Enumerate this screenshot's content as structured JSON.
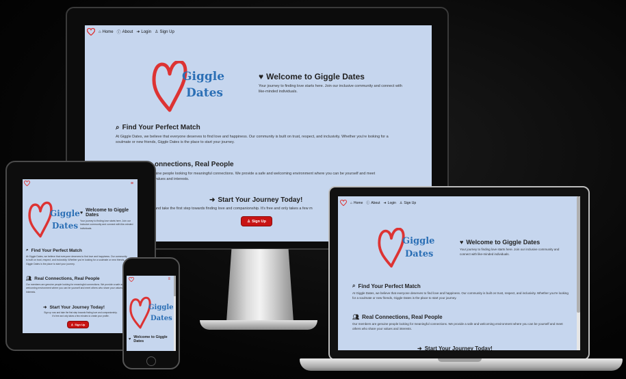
{
  "site": {
    "brand_line1": "Giggle",
    "brand_line2": "Dates",
    "nav": {
      "home": "Home",
      "about": "About",
      "login": "Login",
      "signup": "Sign Up"
    },
    "welcome": {
      "title": "Welcome to Giggle Dates",
      "text": "Your journey to finding love starts here. Join our inclusive community and connect with like-minded individuals."
    },
    "find": {
      "title": "Find Your Perfect Match",
      "text": "At Giggle Dates, we believe that everyone deserves to find love and happiness. Our community is built on trust, respect, and inclusivity. Whether you're looking for a soulmate or new friends, Giggle Dates is the place to start your journey."
    },
    "real": {
      "title": "Real Connections, Real People",
      "title_partial": "onnections, Real People",
      "text": "Our members are genuine people looking for meaningful connections. We provide a safe and welcoming environment where you can be yourself and meet others who share your values and interests.",
      "text_partial": "uine people looking for meaningful connections. We provide a safe and welcoming environment where you can be yourself and meet",
      "text_partial2": "values and interests."
    },
    "journey": {
      "title": "Start Your Journey Today!",
      "text": "Sign up now and take the first step towards finding love and companionship. It's free and only takes a few minutes to create your profile.",
      "text_partial": "and take the first step towards finding love and companionship. It's free and only takes a few m",
      "ipad_text_line1": "Sign up now and take the first step towards finding love and companionship.",
      "ipad_text_line2": "It's free and only takes a few minutes to create your profile.",
      "button": "Sign Up"
    }
  },
  "colors": {
    "page_bg": "#c6d6ee",
    "brand_blue": "#2b6fb5",
    "heart_red": "#d33333",
    "button_red": "#c81414"
  },
  "icons": [
    "heart-logo-icon",
    "home-icon",
    "info-icon",
    "login-icon",
    "user-plus-icon",
    "heart-icon",
    "search-icon",
    "users-icon",
    "sign-in-icon",
    "hamburger-icon"
  ]
}
